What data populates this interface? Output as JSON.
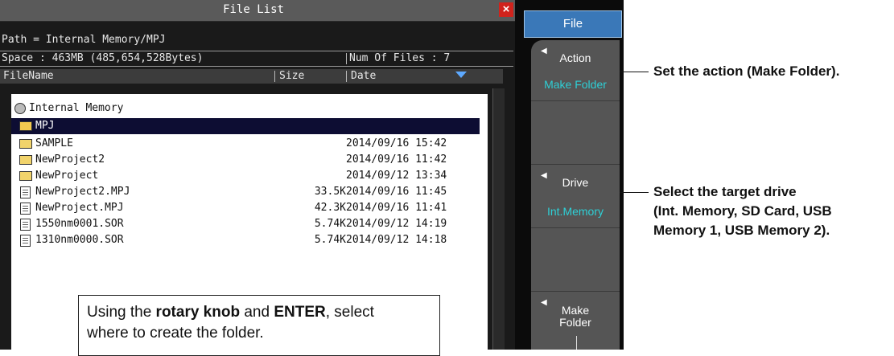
{
  "dialog": {
    "title": "File List",
    "close_label": "×",
    "path": "Path = Internal Memory/MPJ",
    "space": "Space : 463MB (485,654,528Bytes)",
    "num_files": "Num Of Files : 7",
    "columns": {
      "filename": "FileName",
      "size": "Size",
      "date": "Date"
    }
  },
  "tree": {
    "root": "Internal Memory",
    "selected": "MPJ",
    "items": [
      {
        "name": "SAMPLE",
        "size": "",
        "date": "2014/09/16 15:42",
        "icon": "folder-icon"
      },
      {
        "name": "NewProject2",
        "size": "",
        "date": "2014/09/16 11:42",
        "icon": "folder-icon"
      },
      {
        "name": "NewProject",
        "size": "",
        "date": "2014/09/12 13:34",
        "icon": "folder-icon"
      },
      {
        "name": "NewProject2.MPJ",
        "size": "33.5K",
        "date": "2014/09/16 11:45",
        "icon": "file-icon"
      },
      {
        "name": "NewProject.MPJ",
        "size": "42.3K",
        "date": "2014/09/16 11:41",
        "icon": "file-icon"
      },
      {
        "name": "1550nm0001.SOR",
        "size": "5.74K",
        "date": "2014/09/12 14:19",
        "icon": "file-icon"
      },
      {
        "name": "1310nm0000.SOR",
        "size": "5.74K",
        "date": "2014/09/12 14:18",
        "icon": "file-icon"
      }
    ]
  },
  "callout": {
    "t1": "Using the ",
    "b1": "rotary knob",
    "t2": " and ",
    "b2": "ENTER",
    "t3": ", select",
    "line2": "where to create the folder."
  },
  "panel": {
    "file_tab": "File",
    "keys": [
      {
        "label": "Action",
        "value": "Make Folder"
      },
      {
        "label": "Drive",
        "value": "Int.Memory"
      },
      {
        "label_line1": "Make",
        "label_line2": "Folder"
      }
    ]
  },
  "annotations": {
    "action": "Set the action (Make Folder).",
    "drive_line1": "Select the target drive",
    "drive_line2": "(Int. Memory, SD Card, USB",
    "drive_line3": "Memory 1, USB Memory 2)."
  },
  "colors": {
    "selected_row": "#0d0d33",
    "file_tab": "#3a78b8",
    "value_text": "#2ed0d6",
    "close_button": "#d0231c"
  }
}
